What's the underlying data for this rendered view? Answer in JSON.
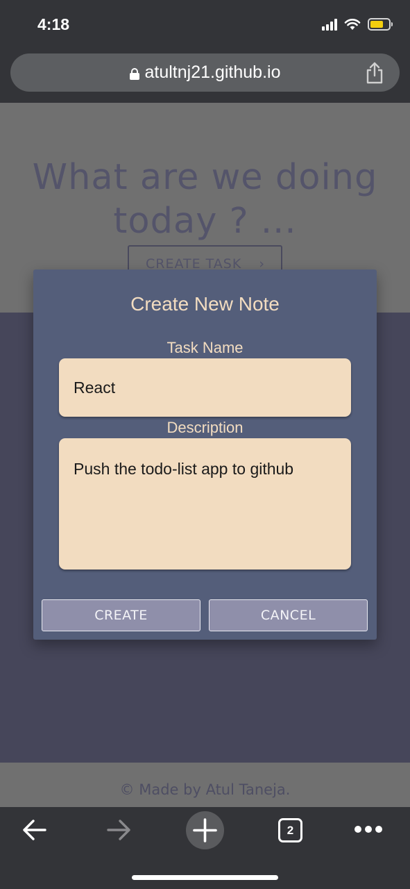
{
  "status_bar": {
    "time": "4:18",
    "icons": [
      "signal-icon",
      "wifi-icon",
      "battery-icon"
    ],
    "battery_color": "#f3ce0e"
  },
  "browser": {
    "url": "atultnj21.github.io",
    "tab_count": "2"
  },
  "page": {
    "heading": "What are we doing today ? ...",
    "create_task_label": "CREATE TASK",
    "footer": "© Made by Atul Taneja."
  },
  "modal": {
    "title": "Create New Note",
    "task_name_label": "Task Name",
    "task_name_value": "React",
    "description_label": "Description",
    "description_value": "Push the todo-list app to github",
    "create_label": "CREATE",
    "cancel_label": "CANCEL"
  },
  "colors": {
    "modal_bg": "#545e7a",
    "field_bg": "#f2dcc0",
    "button_bg": "#8f8faa",
    "page_bg": "#46465a",
    "chrome_bg": "#333438"
  }
}
